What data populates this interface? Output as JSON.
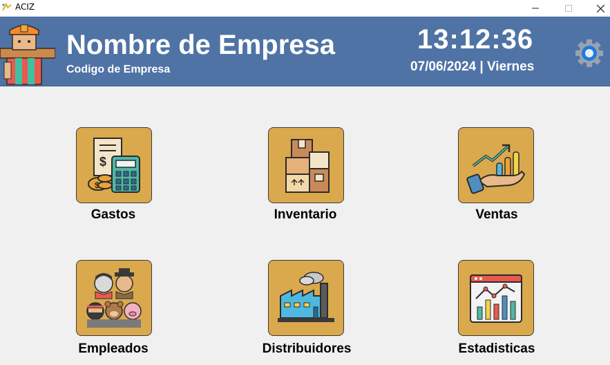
{
  "window": {
    "title": "ACIZ"
  },
  "header": {
    "company_name": "Nombre de Empresa",
    "company_code": "Codigo de Empresa",
    "time": "13:12:36",
    "date": "07/06/2024 | Viernes"
  },
  "modules": [
    {
      "label": "Gastos",
      "icon": "expenses-calculator-icon"
    },
    {
      "label": "Inventario",
      "icon": "inventory-boxes-icon"
    },
    {
      "label": "Ventas",
      "icon": "sales-growth-hand-icon"
    },
    {
      "label": "Empleados",
      "icon": "employees-group-icon"
    },
    {
      "label": "Distribuidores",
      "icon": "factory-icon"
    },
    {
      "label": "Estadisticas",
      "icon": "statistics-dashboard-icon"
    }
  ],
  "colors": {
    "header": "#4f73a5",
    "tile": "#daa84d",
    "background": "#f0f0f0"
  }
}
